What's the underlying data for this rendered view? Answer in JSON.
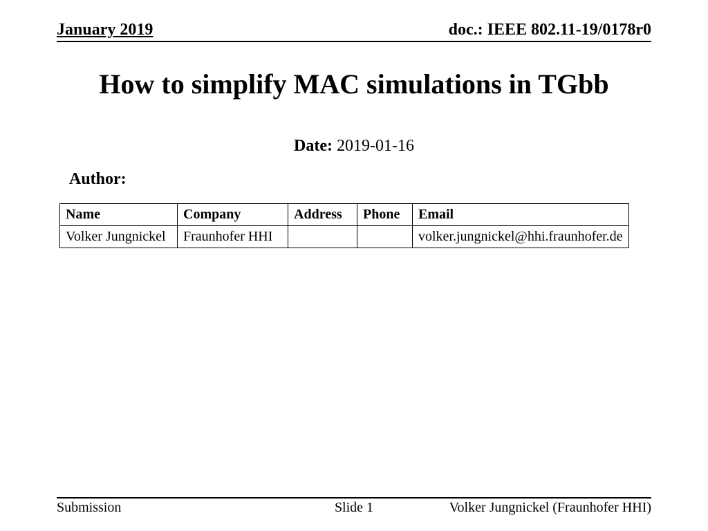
{
  "header": {
    "date_label": "January 2019",
    "doc_number": "doc.: IEEE 802.11-19/0178r0"
  },
  "title": "How to simplify MAC simulations in TGbb",
  "date": {
    "label": "Date:",
    "value": "2019-01-16"
  },
  "author_label": "Author:",
  "author_table": {
    "headers": {
      "name": "Name",
      "company": "Company",
      "address": "Address",
      "phone": "Phone",
      "email": "Email"
    },
    "rows": [
      {
        "name": "Volker Jungnickel",
        "company": "Fraunhofer HHI",
        "address": "",
        "phone": "",
        "email": "volker.jungnickel@hhi.fraunhofer.de"
      }
    ]
  },
  "footer": {
    "left": "Submission",
    "center": "Slide 1",
    "right": "Volker Jungnickel (Fraunhofer HHI)"
  }
}
